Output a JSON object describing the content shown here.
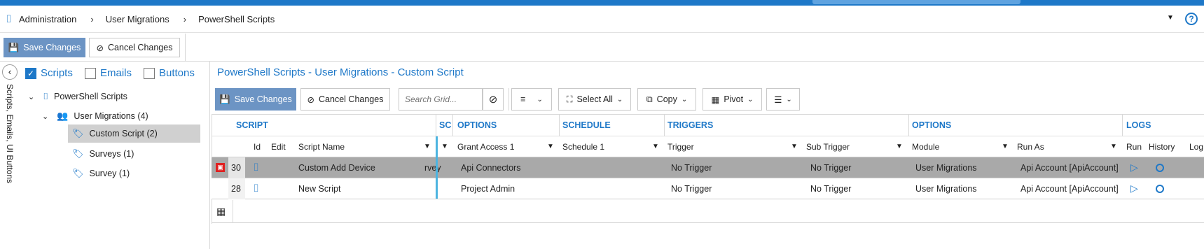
{
  "breadcrumb": {
    "items": [
      "Administration",
      "User Migrations",
      "PowerShell Scripts"
    ]
  },
  "toolbar": {
    "save_label": "Save Changes",
    "cancel_label": "Cancel Changes"
  },
  "left_panel": {
    "side_label": "Scripts, Emails, UI Buttons",
    "filters": [
      {
        "label": "Scripts",
        "checked": true
      },
      {
        "label": "Emails",
        "checked": false
      },
      {
        "label": "Buttons",
        "checked": false
      }
    ],
    "tree": [
      {
        "label": "PowerShell Scripts",
        "level": 1,
        "expanded": true
      },
      {
        "label": "User Migrations (4)",
        "level": 2,
        "expanded": true
      },
      {
        "label": "Custom Script (2)",
        "level": 3,
        "selected": true
      },
      {
        "label": "Surveys (1)",
        "level": 3
      },
      {
        "label": "Survey (1)",
        "level": 3
      }
    ]
  },
  "grid": {
    "title": "PowerShell Scripts - User Migrations - Custom Script",
    "toolbar": {
      "save_label": "Save Changes",
      "cancel_label": "Cancel Changes",
      "search_placeholder": "Search Grid...",
      "select_all_label": "Select All",
      "copy_label": "Copy",
      "pivot_label": "Pivot"
    },
    "groups": [
      "SCRIPT",
      "SC",
      "OPTIONS",
      "SCHEDULE",
      "TRIGGERS",
      "OPTIONS",
      "LOGS"
    ],
    "columns": [
      "Id",
      "Edit",
      "Script Name",
      "Grant Access 1",
      "Schedule 1",
      "Trigger",
      "Sub Trigger",
      "Module",
      "Run As",
      "Run",
      "History",
      "Log"
    ],
    "rows": [
      {
        "id": "30",
        "name": "Custom Add Device",
        "sc": "rvey",
        "grant": "Api Connectors",
        "schedule": "",
        "trigger": "No Trigger",
        "sub_trigger": "No Trigger",
        "module": "User Migrations",
        "run_as": "Api Account [ApiAccount]",
        "selected": true
      },
      {
        "id": "28",
        "name": "New Script",
        "sc": "",
        "grant": "Project Admin",
        "schedule": "",
        "trigger": "No Trigger",
        "sub_trigger": "No Trigger",
        "module": "User Migrations",
        "run_as": "Api Account [ApiAccount]",
        "selected": false
      }
    ]
  },
  "colors": {
    "accent": "#1e78c8",
    "primary_button": "#6c94c4",
    "selected_row": "#a9a9a9",
    "tree_selected": "#d0d0d0"
  }
}
